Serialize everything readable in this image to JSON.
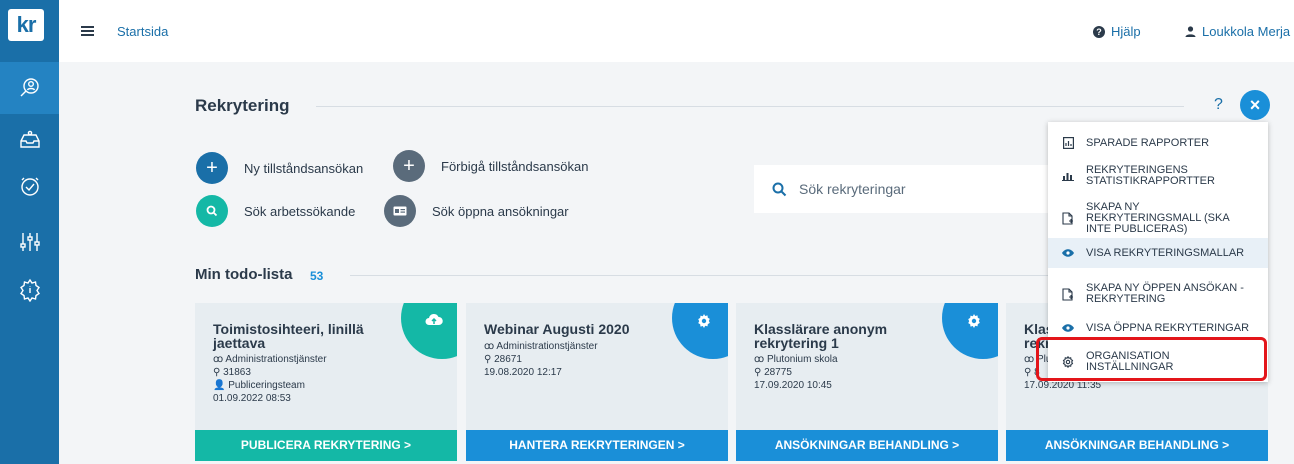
{
  "logo": "kr",
  "header": {
    "breadcrumb": "Startsida",
    "help": "Hjälp",
    "user": "Loukkola Merja"
  },
  "sidebar": {
    "icons": [
      "search-people-icon",
      "inbox-icon",
      "check-circle-icon",
      "sliders-icon",
      "settings-info-icon"
    ]
  },
  "main": {
    "title": "Rekrytering",
    "help_mark": "?",
    "close": "×",
    "actions": [
      {
        "label": "Ny tillståndsansökan",
        "icon": "+"
      },
      {
        "label": "Förbigå tillståndsansökan",
        "icon": "+"
      },
      {
        "label": "Sök arbetssökande",
        "icon": "search-icon"
      },
      {
        "label": "Sök öppna ansökningar",
        "icon": "id-card-icon"
      }
    ],
    "search_placeholder": "Sök rekryteringar"
  },
  "todo": {
    "title": "Min todo-lista",
    "count": "53",
    "cards": [
      {
        "title": "Toimistosihteeri, linillä jaettava",
        "org": "Administrationstjänster",
        "id": "31863",
        "team": "Publiceringsteam",
        "date": "01.09.2022 08:53",
        "button": "PUBLICERA REKRYTERING  >"
      },
      {
        "title": "Webinar Augusti 2020",
        "org": "Administrationstjänster",
        "id": "28671",
        "date": "19.08.2020 12:17",
        "button": "HANTERA REKRYTERINGEN  >"
      },
      {
        "title": "Klasslärare anonym rekrytering 1",
        "org": "Plutonium skola",
        "id": "28775",
        "date": "17.09.2020 10:45",
        "button": "ANSÖKNINGAR BEHANDLING  >"
      },
      {
        "title": "Klass rekr",
        "org": "Plu",
        "id": "8",
        "date": "17.09.2020 11:35",
        "button": "ANSÖKNINGAR BEHANDLING  >"
      }
    ]
  },
  "dropdown": {
    "items": [
      {
        "label": "SPARADE RAPPORTER"
      },
      {
        "label": "REKRYTERINGENS STATISTIKRAPPORTTER"
      },
      {
        "label": "SKAPA NY REKRYTERINGSMALL (SKA INTE PUBLICERAS)"
      },
      {
        "label": "VISA REKRYTERINGSMALLAR"
      },
      {
        "label": "SKAPA NY ÖPPEN ANSÖKAN - REKRYTERING"
      },
      {
        "label": "VISA ÖPPNA REKRYTERINGAR"
      },
      {
        "label": "ORGANISATION INSTÄLLNINGAR"
      }
    ]
  },
  "colors": {
    "sidebar": "#1a6fa8",
    "accent": "#1a8fd8",
    "teal": "#14b8a6",
    "highlight": "#e3151a"
  }
}
